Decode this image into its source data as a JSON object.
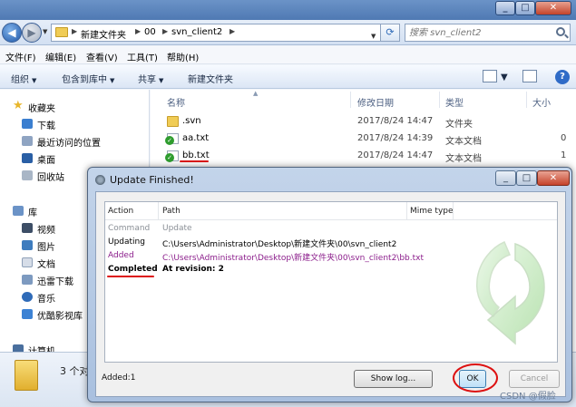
{
  "explorer": {
    "address": {
      "crumbs": [
        "新建文件夹",
        "00",
        "svn_client2"
      ],
      "search_placeholder": "搜索 svn_client2"
    },
    "menu": [
      "文件(F)",
      "编辑(E)",
      "查看(V)",
      "工具(T)",
      "帮助(H)"
    ],
    "toolbar": {
      "organize": "组织",
      "include_in_library": "包含到库中",
      "share": "共享",
      "new_folder": "新建文件夹"
    },
    "nav": {
      "favorites": "收藏夹",
      "favorites_items": [
        "下载",
        "最近访问的位置",
        "桌面",
        "回收站"
      ],
      "libraries": "库",
      "library_items": [
        "视频",
        "图片",
        "文档",
        "迅雷下载",
        "音乐",
        "优酷影视库"
      ],
      "computer": "计算机"
    },
    "columns": {
      "name": "名称",
      "date": "修改日期",
      "type": "类型",
      "size": "大小"
    },
    "files": [
      {
        "name": ".svn",
        "date": "2017/8/24 14:47",
        "type": "文件夹",
        "size": ""
      },
      {
        "name": "aa.txt",
        "date": "2017/8/24 14:39",
        "type": "文本文档",
        "size": "0"
      },
      {
        "name": "bb.txt",
        "date": "2017/8/24 14:47",
        "type": "文本文档",
        "size": "1"
      }
    ],
    "status": "3 个对象"
  },
  "dialog": {
    "title": "Update Finished!",
    "columns": {
      "action": "Action",
      "path": "Path",
      "mime": "Mime type"
    },
    "rows": [
      {
        "action": "Command",
        "path": "Update"
      },
      {
        "action": "Updating",
        "path": "C:\\Users\\Administrator\\Desktop\\新建文件夹\\00\\svn_client2"
      },
      {
        "action": "Added",
        "path": "C:\\Users\\Administrator\\Desktop\\新建文件夹\\00\\svn_client2\\bb.txt"
      },
      {
        "action": "Completed",
        "path": "At revision: 2"
      }
    ],
    "added_count": "Added:1",
    "buttons": {
      "show_log": "Show log...",
      "ok": "OK",
      "cancel": "Cancel"
    }
  },
  "watermark": "CSDN @假脸",
  "colors": {
    "annotation_red": "#dd1111",
    "added_purple": "#8b1d8b"
  }
}
